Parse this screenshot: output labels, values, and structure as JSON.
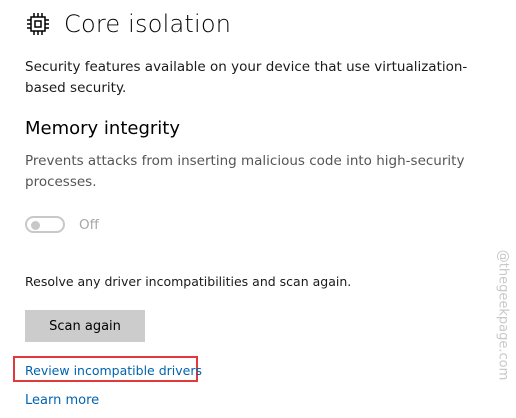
{
  "header": {
    "icon": "chip-icon",
    "title": "Core isolation"
  },
  "intro": {
    "description": "Security features available on your device that use virtualization-based security."
  },
  "memory_integrity": {
    "title": "Memory integrity",
    "description": "Prevents attacks from inserting malicious code into high-security processes.",
    "toggle": {
      "state": "off",
      "label": "Off",
      "enabled": false
    }
  },
  "resolve": {
    "text": "Resolve any driver incompatibilities and scan again.",
    "scan_button_label": "Scan again",
    "review_link_label": "Review incompatible drivers",
    "learn_more_label": "Learn more"
  },
  "annotation": {
    "highlight_color": "#e0393e"
  },
  "watermark": {
    "text": "@thegeekpage.com"
  },
  "colors": {
    "link": "#0063b1",
    "button_bg": "#cccccc",
    "toggle_disabled": "#c8c8c8"
  }
}
